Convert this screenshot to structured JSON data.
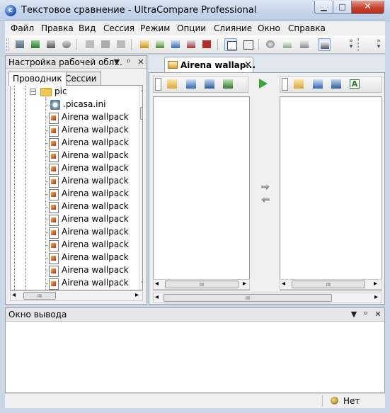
{
  "window": {
    "title": "Текстовое сравнение - UltraCompare Professional",
    "app_icon_letter": "c",
    "minimize_glyph": "▁",
    "maximize_glyph": "□",
    "close_glyph": "✕"
  },
  "menu": [
    "Файл",
    "Правка",
    "Вид",
    "Сессия",
    "Режим",
    "Опции",
    "Слияние",
    "Окно",
    "Справка"
  ],
  "workspace_panel": {
    "title": "Настройка рабочей обл...",
    "tabs": [
      "Проводник",
      "Сессии"
    ],
    "active_tab": "Проводник",
    "tree": {
      "folder": "pic",
      "files": [
        ".picasa.ini",
        "Airena wallpack",
        "Airena wallpack",
        "Airena wallpack",
        "Airena wallpack",
        "Airena wallpack",
        "Airena wallpack",
        "Airena wallpack",
        "Airena wallpack",
        "Airena wallpack",
        "Airena wallpack",
        "Airena wallpack",
        "Airena wallpack",
        "Airena wallpack",
        "Airena wallpack"
      ]
    }
  },
  "document_tab": {
    "label": "Airena wallap...",
    "close_glyph": "×"
  },
  "output_panel": {
    "title": "Окно вывода"
  },
  "statusbar": {
    "text": "Нет"
  },
  "panel_glyphs": {
    "dropdown": "▼",
    "pin": "ᵖ",
    "close": "✕"
  },
  "scroll_glyphs": {
    "left": "◂",
    "right": "▸",
    "up": "▴",
    "down": "▾",
    "thumb": "III"
  },
  "colors": {
    "title_gradient_top": "#dbe7f4",
    "close_button": "#c7422a",
    "run_arrow": "#3aa63a",
    "folder": "#f3c552"
  }
}
